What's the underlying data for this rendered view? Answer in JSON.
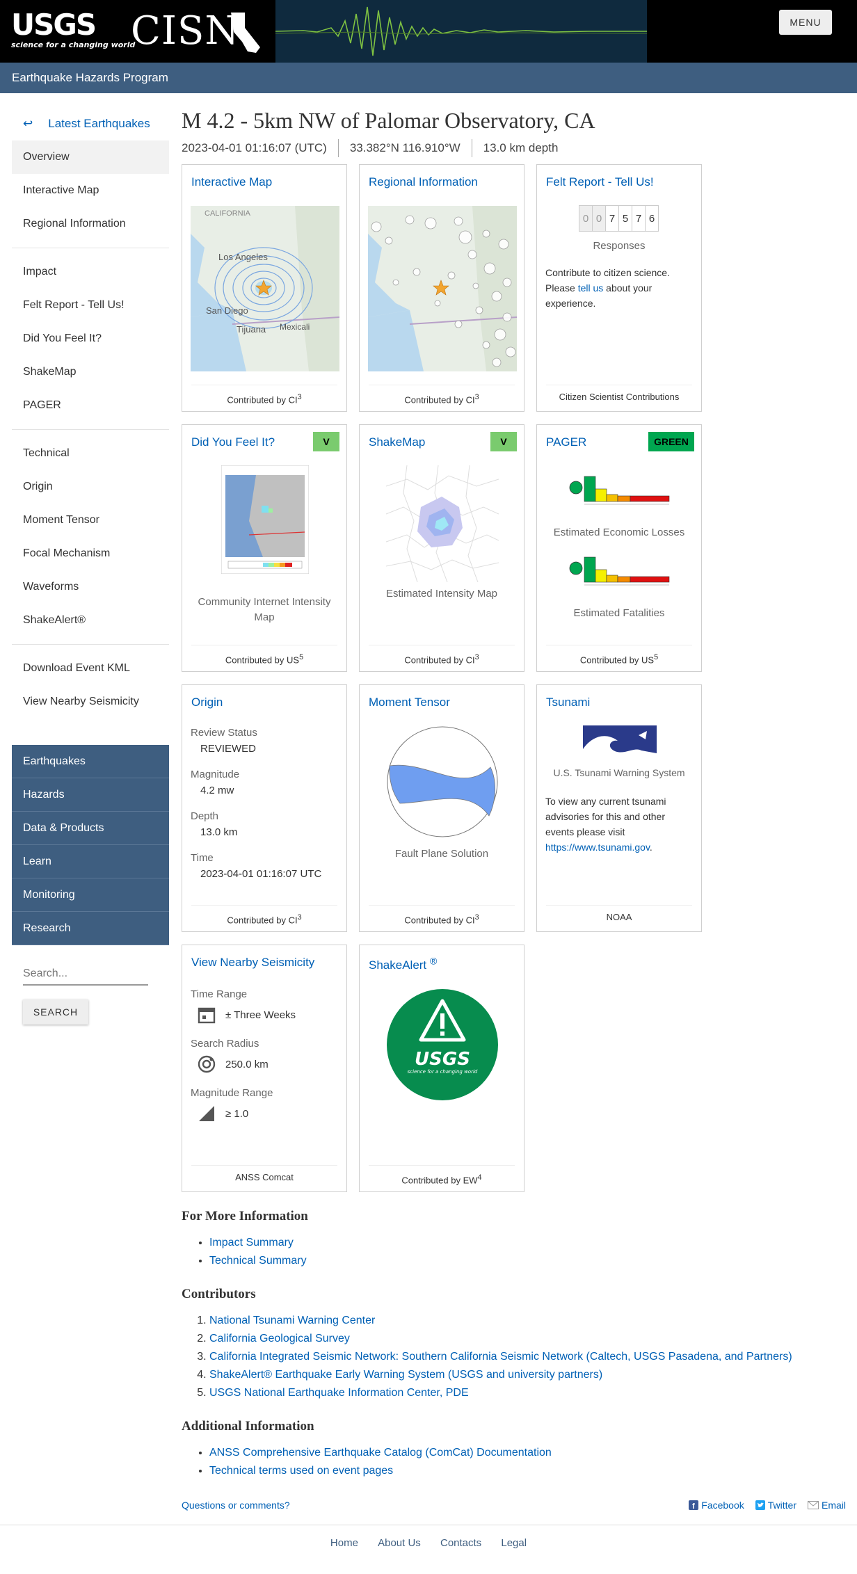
{
  "header": {
    "usgs_logo": "USGS",
    "usgs_tagline": "science for a changing world",
    "cisn_logo": "CISN",
    "menu_label": "MENU",
    "program": "Earthquake Hazards Program"
  },
  "sidebar": {
    "back_label": "Latest Earthquakes",
    "group1": [
      "Overview",
      "Interactive Map",
      "Regional Information"
    ],
    "group2": [
      "Impact",
      "Felt Report - Tell Us!",
      "Did You Feel It?",
      "ShakeMap",
      "PAGER"
    ],
    "group3": [
      "Technical",
      "Origin",
      "Moment Tensor",
      "Focal Mechanism",
      "Waveforms",
      "ShakeAlert®"
    ],
    "group4": [
      "Download Event KML",
      "View Nearby Seismicity"
    ],
    "blue_nav": [
      "Earthquakes",
      "Hazards",
      "Data & Products",
      "Learn",
      "Monitoring",
      "Research"
    ],
    "search_placeholder": "Search...",
    "search_button": "SEARCH"
  },
  "event": {
    "title": "M 4.2 - 5km NW of Palomar Observatory, CA",
    "time": "2023-04-01 01:16:07 (UTC)",
    "location": "33.382°N 116.910°W",
    "depth": "13.0 km depth"
  },
  "cards": {
    "interactive_map": {
      "title": "Interactive Map",
      "foot_prefix": "Contributed by",
      "source": "CI",
      "num": "3"
    },
    "regional": {
      "title": "Regional Information",
      "foot_prefix": "Contributed by",
      "source": "CI",
      "num": "3"
    },
    "felt": {
      "title": "Felt Report - Tell Us!",
      "digits": [
        "0",
        "0",
        "7",
        "5",
        "7",
        "6"
      ],
      "responses": "Responses",
      "text_a": "Contribute to citizen science. Please ",
      "link": "tell us",
      "text_b": " about your experience.",
      "foot": "Citizen Scientist Contributions"
    },
    "dyfi": {
      "title": "Did You Feel It?",
      "badge": "V",
      "caption": "Community Internet Intensity Map",
      "foot_prefix": "Contributed by",
      "source": "US",
      "num": "5"
    },
    "shakemap": {
      "title": "ShakeMap",
      "badge": "V",
      "caption": "Estimated Intensity Map",
      "foot_prefix": "Contributed by",
      "source": "CI",
      "num": "3"
    },
    "pager": {
      "title": "PAGER",
      "badge": "GREEN",
      "caption1": "Estimated Economic Losses",
      "caption2": "Estimated Fatalities",
      "foot_prefix": "Contributed by",
      "source": "US",
      "num": "5"
    },
    "origin": {
      "title": "Origin",
      "review_label": "Review Status",
      "review": "REVIEWED",
      "mag_label": "Magnitude",
      "mag": "4.2 mw",
      "depth_label": "Depth",
      "depth": "13.0 km",
      "time_label": "Time",
      "time": "2023-04-01 01:16:07 UTC",
      "foot_prefix": "Contributed by",
      "source": "CI",
      "num": "3"
    },
    "moment": {
      "title": "Moment Tensor",
      "caption": "Fault Plane Solution",
      "foot_prefix": "Contributed by",
      "source": "CI",
      "num": "3"
    },
    "tsunami": {
      "title": "Tsunami",
      "caption": "U.S. Tsunami Warning System",
      "text": "To view any current tsunami advisories for this and other events please visit",
      "link": "https://www.tsunami.gov",
      "foot": "NOAA"
    },
    "nearby": {
      "title": "View Nearby Seismicity",
      "time_label": "Time Range",
      "time": "± Three Weeks",
      "radius_label": "Search Radius",
      "radius": "250.0 km",
      "mag_label": "Magnitude Range",
      "mag": "≥ 1.0",
      "foot": "ANSS Comcat"
    },
    "shakealert": {
      "title": "ShakeAlert",
      "reg": "®",
      "logo_text": "USGS",
      "logo_tag": "science for a changing world",
      "foot_prefix": "Contributed by",
      "source": "EW",
      "num": "4"
    }
  },
  "more_info": {
    "heading": "For More Information",
    "links": [
      "Impact Summary",
      "Technical Summary"
    ]
  },
  "contributors": {
    "heading": "Contributors",
    "items": [
      "National Tsunami Warning Center",
      "California Geological Survey",
      "California Integrated Seismic Network: Southern California Seismic Network (Caltech, USGS Pasadena, and Partners)",
      "ShakeAlert® Earthquake Early Warning System (USGS and university partners)",
      "USGS National Earthquake Information Center, PDE"
    ]
  },
  "additional": {
    "heading": "Additional Information",
    "links": [
      "ANSS Comprehensive Earthquake Catalog (ComCat) Documentation",
      "Technical terms used on event pages"
    ]
  },
  "social": {
    "questions": "Questions or comments?",
    "facebook": "Facebook",
    "twitter": "Twitter",
    "email": "Email"
  },
  "footer": [
    "Home",
    "About Us",
    "Contacts",
    "Legal"
  ],
  "map_labels": {
    "california": "CALIFORNIA",
    "los_angeles": "Los Angeles",
    "san_diego": "San Diego",
    "tijuana": "Tijuana",
    "mexicali": "Mexicali"
  },
  "colors": {
    "nav_blue": "#3e5e80",
    "link": "#0060b5",
    "pager_green": "#00a650",
    "badge_v": "#7acb6e",
    "shakealert_green": "#078c4e"
  }
}
